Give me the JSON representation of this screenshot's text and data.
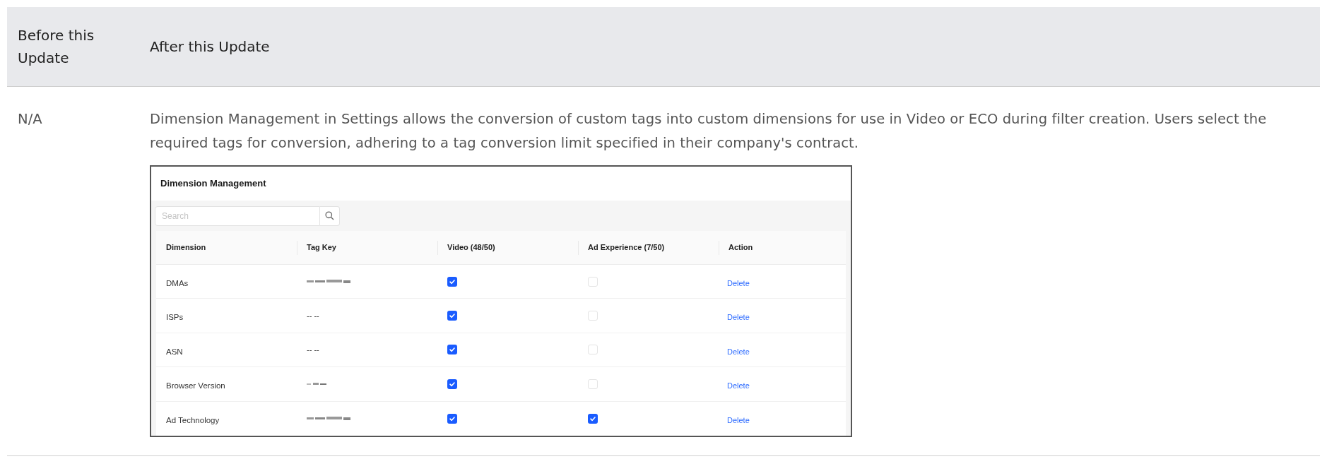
{
  "table": {
    "columns": [
      "Before this Update",
      "After this Update"
    ],
    "rows": [
      {
        "before": "N/A",
        "after": {
          "text": "Dimension Management in Settings allows the conversion of custom tags into custom dimensions for use in Video or ECO during filter creation. Users select the required tags for conversion, adhering to a tag conversion limit specified in their company's contract.",
          "screenshot": {
            "title": "Dimension Management",
            "search": {
              "placeholder": "Search"
            },
            "columns": [
              "Dimension",
              "Tag Key",
              "Video (48/50)",
              "Ad Experience (7/50)",
              "Action"
            ],
            "rows": [
              {
                "dimension": "DMAs",
                "tag_key": {
                  "kind": "blurred"
                },
                "video": true,
                "ad_experience": false,
                "action": "Delete"
              },
              {
                "dimension": "ISPs",
                "tag_key": {
                  "kind": "text",
                  "text": "-- --"
                },
                "video": true,
                "ad_experience": false,
                "action": "Delete"
              },
              {
                "dimension": "ASN",
                "tag_key": {
                  "kind": "text",
                  "text": "-- --"
                },
                "video": true,
                "ad_experience": false,
                "action": "Delete"
              },
              {
                "dimension": "Browser Version",
                "tag_key": {
                  "kind": "blurred_short"
                },
                "video": true,
                "ad_experience": false,
                "action": "Delete"
              },
              {
                "dimension": "Ad Technology",
                "tag_key": {
                  "kind": "blurred"
                },
                "video": true,
                "ad_experience": true,
                "action": "Delete"
              }
            ]
          }
        }
      }
    ]
  }
}
